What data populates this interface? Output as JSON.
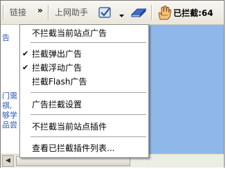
{
  "toolbar": {
    "links_label": "链接",
    "overflow_glyph": "»",
    "assistant_label": "上网助手",
    "blocked_label": "已拦截:64"
  },
  "menu": {
    "items": [
      {
        "label": "不拦截当前站点广告",
        "checked": false
      },
      {
        "label": "拦截弹出广告",
        "checked": true
      },
      {
        "label": "拦截浮动广告",
        "checked": true
      },
      {
        "label": "拦截Flash广告",
        "checked": false
      },
      {
        "label": "广告拦截设置",
        "checked": false
      },
      {
        "label": "不拦截当前站点插件",
        "checked": false
      },
      {
        "label": "查看已拦截插件列表...",
        "checked": false
      }
    ],
    "check_glyph": "✔"
  },
  "page": {
    "fragments": [
      "告",
      "门需",
      "祺,",
      "够学",
      "品尝"
    ]
  },
  "icons": [
    "shield-check-icon",
    "dropdown-arrow-icon",
    "eraser-icon",
    "hand-stop-icon"
  ]
}
